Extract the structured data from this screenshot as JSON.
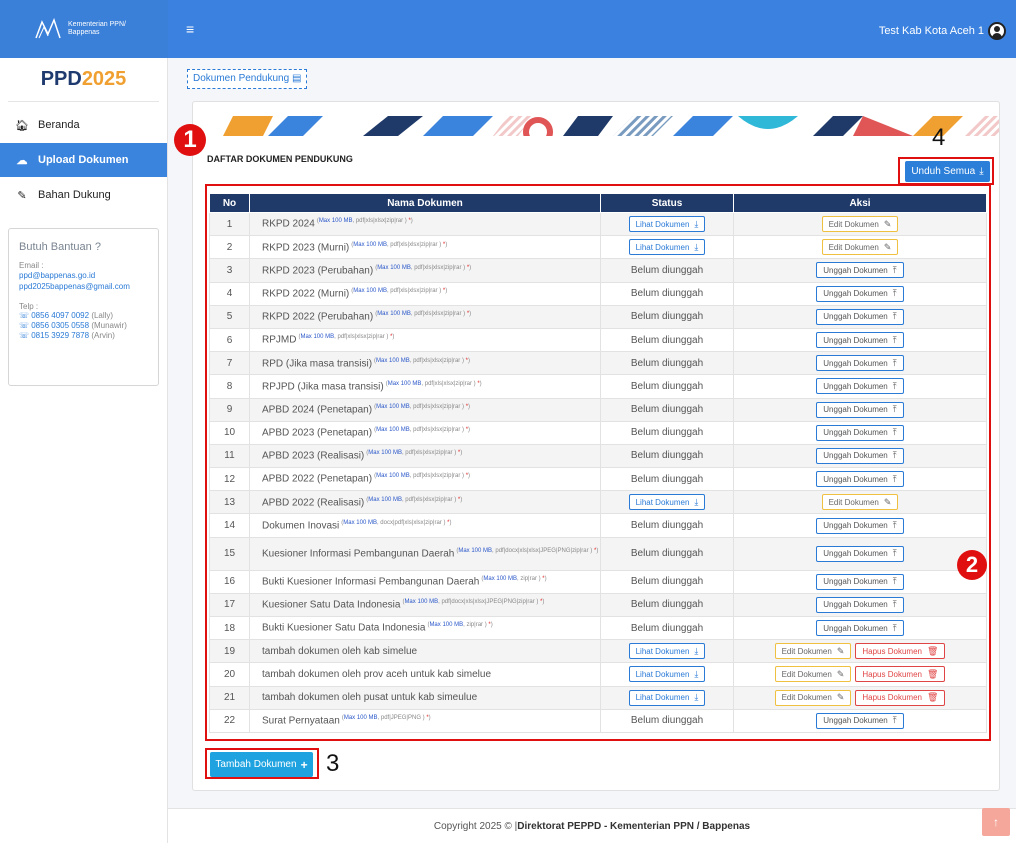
{
  "topbar": {
    "brand_line1": "Kementerian PPN/",
    "brand_line2": "Bappenas",
    "user_name": "Test Kab Kota Aceh 1"
  },
  "sidebar": {
    "title_prefix": "PPD",
    "title_year": "2025",
    "items": [
      {
        "label": "Beranda",
        "icon": "home-icon"
      },
      {
        "label": "Upload Dokumen",
        "icon": "cloud-icon"
      },
      {
        "label": "Bahan Dukung",
        "icon": "edit-icon"
      }
    ],
    "help": {
      "title": "Butuh Bantuan ?",
      "email_label": "Email :",
      "emails": [
        "ppd@bappenas.go.id",
        "ppd2025bappenas@gmail.com"
      ],
      "phone_label": "Telp :",
      "phones": [
        {
          "number": "0856 4097 0092",
          "name": "(Lally)"
        },
        {
          "number": "0856 0305 0558",
          "name": "(Munawir)"
        },
        {
          "number": "0815 3929 7878",
          "name": "(Arvin)"
        }
      ]
    }
  },
  "breadcrumb": "Dokumen Pendukung",
  "main": {
    "title": "DAFTAR DOKUMEN PENDUKUNG",
    "unduh_label": "Unduh Semua",
    "tambah_label": "Tambah Dokumen",
    "columns": [
      "No",
      "Nama Dokumen",
      "Status",
      "Aksi"
    ],
    "rows": [
      {
        "no": "1",
        "name": "RKPD 2024",
        "max": "Max 100 MB",
        "fmt": "pdf|xls|xlsx|zip|rar )",
        "status": "lihat",
        "actions": [
          "edit"
        ]
      },
      {
        "no": "2",
        "name": "RKPD 2023 (Murni)",
        "max": "Max 100 MB",
        "fmt": "pdf|xls|xlsx|zip|rar )",
        "status": "lihat",
        "actions": [
          "edit"
        ]
      },
      {
        "no": "3",
        "name": "RKPD 2023 (Perubahan)",
        "max": "Max 100 MB",
        "fmt": "pdf|xls|xlsx|zip|rar )",
        "status": "belum",
        "actions": [
          "unggah"
        ]
      },
      {
        "no": "4",
        "name": "RKPD 2022 (Murni)",
        "max": "Max 100 MB",
        "fmt": "pdf|xls|xlsx|zip|rar )",
        "status": "belum",
        "actions": [
          "unggah"
        ]
      },
      {
        "no": "5",
        "name": "RKPD 2022 (Perubahan)",
        "max": "Max 100 MB",
        "fmt": "pdf|xls|xlsx|zip|rar )",
        "status": "belum",
        "actions": [
          "unggah"
        ]
      },
      {
        "no": "6",
        "name": "RPJMD",
        "max": "Max 100 MB",
        "fmt": "pdf|xls|xlsx|zip|rar )",
        "status": "belum",
        "actions": [
          "unggah"
        ]
      },
      {
        "no": "7",
        "name": "RPD (Jika masa transisi)",
        "max": "Max 100 MB",
        "fmt": "pdf|xls|xlsx|zip|rar )",
        "status": "belum",
        "actions": [
          "unggah"
        ]
      },
      {
        "no": "8",
        "name": "RPJPD (Jika masa transisi)",
        "max": "Max 100 MB",
        "fmt": "pdf|xls|xlsx|zip|rar )",
        "status": "belum",
        "actions": [
          "unggah"
        ]
      },
      {
        "no": "9",
        "name": "APBD 2024 (Penetapan)",
        "max": "Max 100 MB",
        "fmt": "pdf|xls|xlsx|zip|rar )",
        "status": "belum",
        "actions": [
          "unggah"
        ]
      },
      {
        "no": "10",
        "name": "APBD 2023 (Penetapan)",
        "max": "Max 100 MB",
        "fmt": "pdf|xls|xlsx|zip|rar )",
        "status": "belum",
        "actions": [
          "unggah"
        ]
      },
      {
        "no": "11",
        "name": "APBD 2023 (Realisasi)",
        "max": "Max 100 MB",
        "fmt": "pdf|xls|xlsx|zip|rar )",
        "status": "belum",
        "actions": [
          "unggah"
        ]
      },
      {
        "no": "12",
        "name": "APBD 2022 (Penetapan)",
        "max": "Max 100 MB",
        "fmt": "pdf|xls|xlsx|zip|rar )",
        "status": "belum",
        "actions": [
          "unggah"
        ]
      },
      {
        "no": "13",
        "name": "APBD 2022 (Realisasi)",
        "max": "Max 100 MB",
        "fmt": "pdf|xls|xlsx|zip|rar )",
        "status": "lihat",
        "actions": [
          "edit"
        ]
      },
      {
        "no": "14",
        "name": "Dokumen Inovasi",
        "max": "Max 100 MB",
        "fmt": "docx|pdf|xls|xlsx|zip|rar )",
        "status": "belum",
        "actions": [
          "unggah"
        ]
      },
      {
        "no": "15",
        "name": "Kuesioner Informasi Pembangunan Daerah",
        "max": "Max 100 MB",
        "fmt": "pdf|docx|xls|xlsx|JPEG|PNG|zip|rar )",
        "status": "belum",
        "actions": [
          "unggah"
        ],
        "tall": true
      },
      {
        "no": "16",
        "name": "Bukti Kuesioner Informasi Pembangunan Daerah",
        "max": "Max 100 MB",
        "fmt": "zip|rar )",
        "status": "belum",
        "actions": [
          "unggah"
        ]
      },
      {
        "no": "17",
        "name": "Kuesioner Satu Data Indonesia",
        "max": "Max 100 MB",
        "fmt": "pdf|docx|xls|xlsx|JPEG|PNG|zip|rar )",
        "status": "belum",
        "actions": [
          "unggah"
        ]
      },
      {
        "no": "18",
        "name": "Bukti Kuesioner Satu Data Indonesia",
        "max": "Max 100 MB",
        "fmt": "zip|rar )",
        "status": "belum",
        "actions": [
          "unggah"
        ]
      },
      {
        "no": "19",
        "name": "tambah dokumen oleh kab simelue",
        "max": "",
        "fmt": "",
        "status": "lihat",
        "actions": [
          "edit",
          "hapus"
        ]
      },
      {
        "no": "20",
        "name": "tambah dokumen oleh prov aceh untuk kab simelue",
        "max": "",
        "fmt": "",
        "status": "lihat",
        "actions": [
          "edit",
          "hapus"
        ]
      },
      {
        "no": "21",
        "name": "tambah dokumen oleh pusat untuk kab simeulue",
        "max": "",
        "fmt": "",
        "status": "lihat",
        "actions": [
          "edit",
          "hapus"
        ]
      },
      {
        "no": "22",
        "name": "Surat Pernyataan",
        "max": "Max 100 MB",
        "fmt": "pdf|JPEG|PNG )",
        "status": "belum",
        "actions": [
          "unggah"
        ]
      }
    ],
    "labels": {
      "lihat": "Lihat Dokumen",
      "belum": "Belum diunggah",
      "edit": "Edit Dokumen",
      "unggah": "Unggah Dokumen",
      "hapus": "Hapus Dokumen"
    }
  },
  "annotations": [
    "1",
    "2",
    "3",
    "4"
  ],
  "footer": {
    "prefix": "Copyright 2025 © |",
    "org": "Direktorat PEPPD - Kementerian PPN / Bappenas"
  },
  "colors": {
    "primary": "#3b82e0",
    "table_header": "#1f3a68",
    "annotation": "#e01010"
  }
}
